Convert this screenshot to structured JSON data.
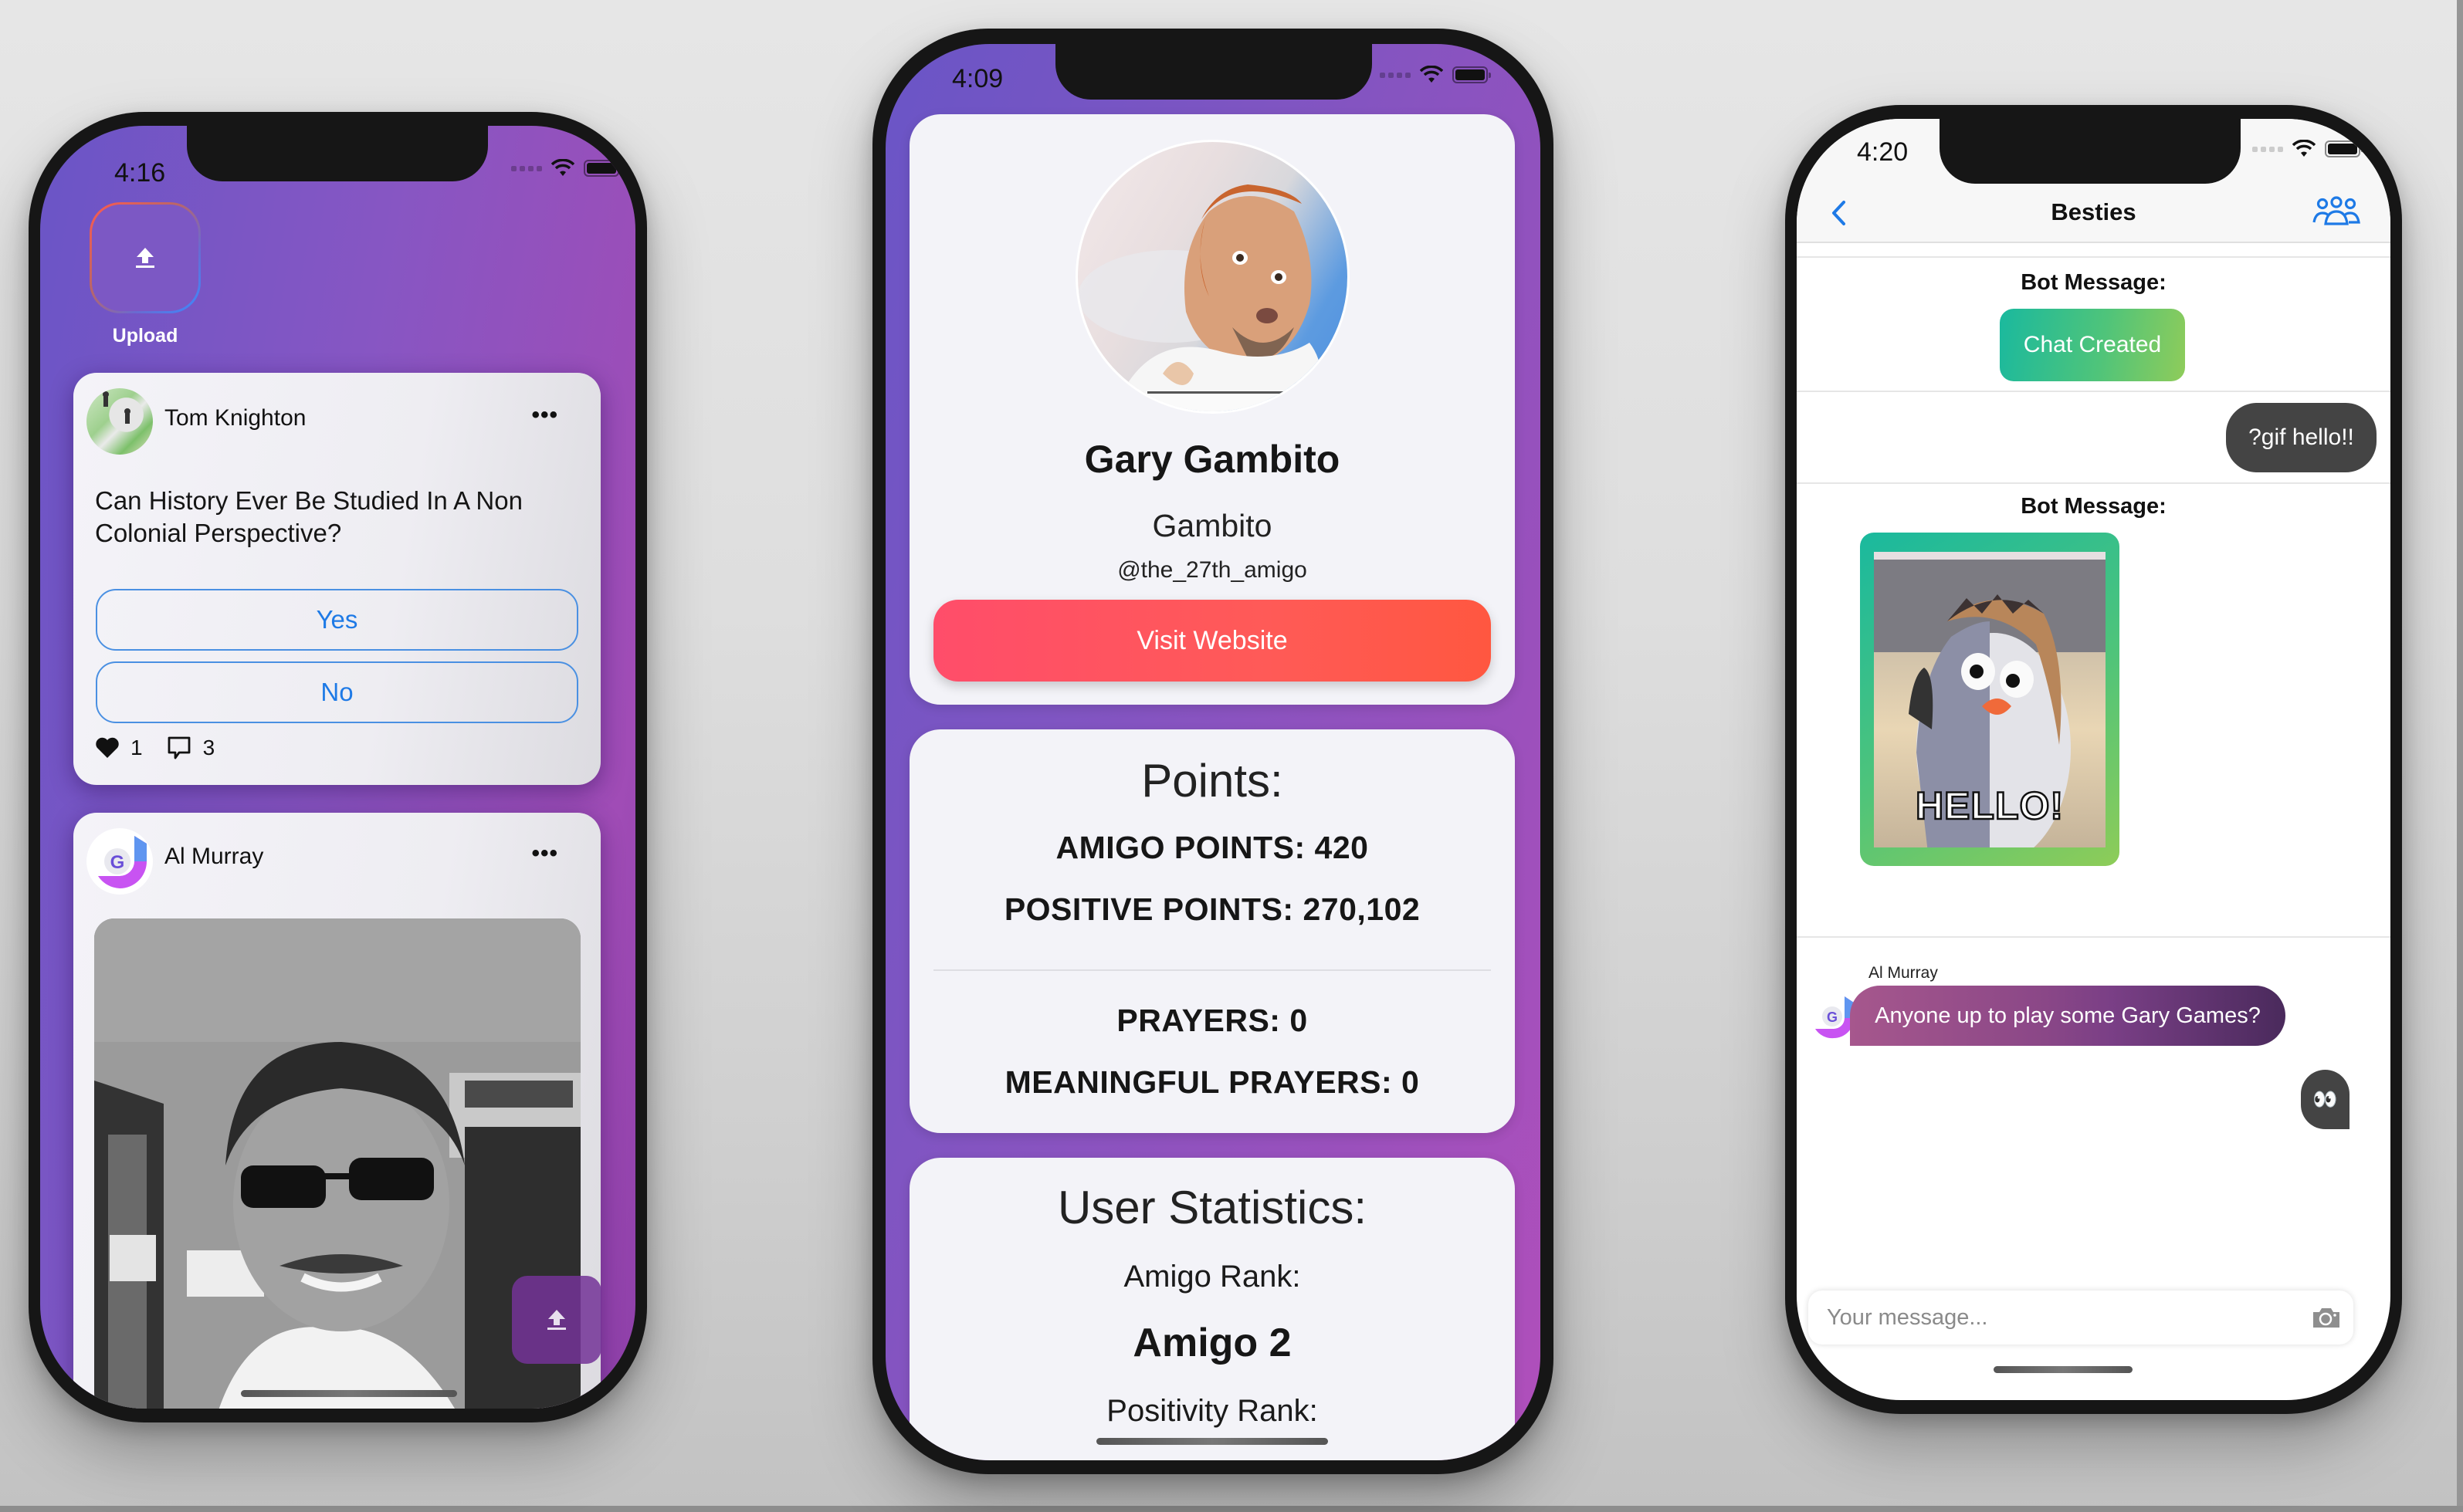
{
  "phones": {
    "feed": {
      "status_time": "4:16",
      "upload_label": "Upload",
      "posts": [
        {
          "author": "Tom Knighton",
          "question": "Can History Ever Be Studied In A Non Colonial Perspective?",
          "options": [
            "Yes",
            "No"
          ],
          "likes": "1",
          "comments": "3",
          "menu_icon": "more-horizontal-icon"
        },
        {
          "author": "Al Murray",
          "menu_icon": "more-horizontal-icon",
          "image": "black-and-white selfie photo"
        }
      ],
      "accent": "#1e7ae6"
    },
    "profile": {
      "status_time": "4:09",
      "name": "Gary Gambito",
      "subtitle": "Gambito",
      "handle": "@the_27th_amigo",
      "visit_button": "Visit Website",
      "points": {
        "title": "Points:",
        "amigo_points": "AMIGO POINTS: 420",
        "positive_points": "POSITIVE POINTS: 270,102",
        "prayers": "PRAYERS: 0",
        "meaningful_prayers": "MEANINGFUL PRAYERS: 0"
      },
      "stats": {
        "title": "User Statistics:",
        "amigo_rank_label": "Amigo Rank:",
        "amigo_rank_value": "Amigo 2",
        "positivity_rank_label": "Positivity Rank:"
      },
      "button_color": "#ff5257"
    },
    "chat": {
      "status_time": "4:20",
      "title": "Besties",
      "messages": [
        {
          "type": "bot",
          "label": "Bot Message:",
          "text": "Chat Created"
        },
        {
          "type": "mine",
          "text": "?gif hello!!"
        },
        {
          "type": "bot",
          "label": "Bot Message:",
          "gif_text": "HELLO!"
        },
        {
          "type": "theirs",
          "sender": "Al Murray",
          "text": "Anyone up to play some Gary Games?"
        },
        {
          "type": "mine",
          "text": "👀"
        }
      ],
      "input_placeholder": "Your message...",
      "accent": "#1e7ae6",
      "bot_gradient": [
        "#1ab99e",
        "#8fcc5a"
      ]
    }
  }
}
